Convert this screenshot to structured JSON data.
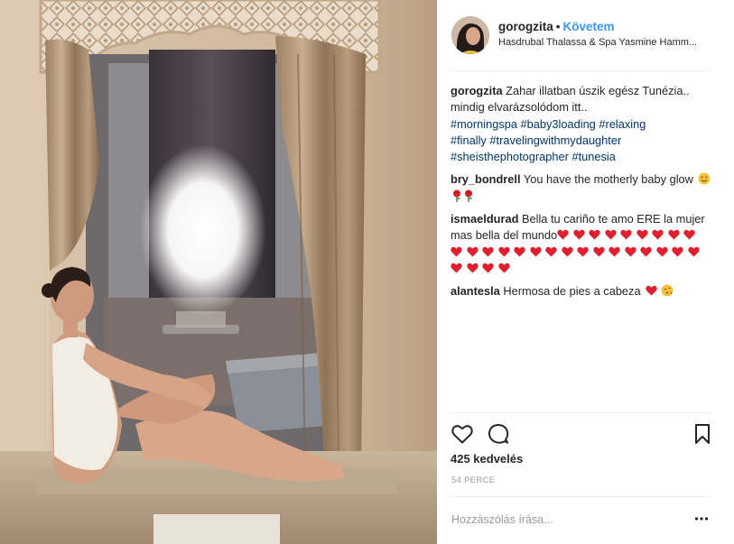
{
  "post": {
    "photo_alt": "",
    "header": {
      "username": "gorogzita",
      "separator": "•",
      "follow_label": "Követem",
      "location": "Hasdrubal Thalassa & Spa Yasmine Hamm..."
    },
    "caption": {
      "username": "gorogzita",
      "text": "Zahar illatban úszik egész Tunézia.. mindig elvarázsolódom itt..",
      "hashtags": [
        "#morningspa",
        "#baby3loading",
        "#relaxing",
        "#finally",
        "#travelingwithmydaughter",
        "#sheisthephotographer",
        "#tunesia"
      ]
    },
    "comments": [
      {
        "username": "bry_bondrell",
        "text": "You have the motherly baby glow",
        "emoji": [
          "smiling-face-icon",
          "rose-icon",
          "rose-icon"
        ]
      },
      {
        "username": "ismaeldurad",
        "text": "Bella tu cariño te amo ERE la mujer mas bella del mundo",
        "heart_count": 29,
        "heart_color": "#e0202f"
      },
      {
        "username": "alantesla",
        "text": "Hermosa de pies a cabeza",
        "emoji": [
          "red-heart-icon",
          "kissing-face-icon"
        ]
      }
    ],
    "actions": {
      "like_icon": "heart-outline-icon",
      "comment_icon": "speech-bubble-icon",
      "save_icon": "bookmark-icon"
    },
    "likes_text": "425 kedvelés",
    "timestamp": "54 PERCE",
    "add_comment_placeholder": "Hozzászólás írása...",
    "more_icon": "more-options-icon",
    "colors": {
      "link_blue": "#3897f0",
      "hashtag": "#003569",
      "muted": "#999999",
      "text": "#262626",
      "heart_red": "#e0202f"
    }
  }
}
